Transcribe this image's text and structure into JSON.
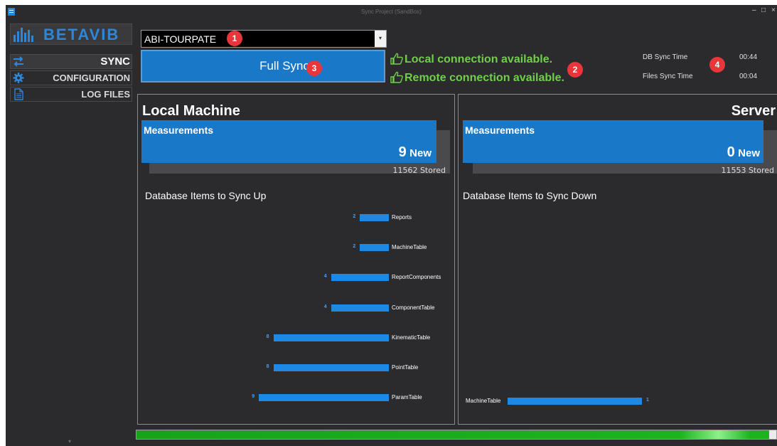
{
  "window": {
    "title": "Sync Project (SandBox)",
    "minimize": "–",
    "maximize": "□",
    "close": "×"
  },
  "sidebar": {
    "logo_text": "BETAVIB",
    "items": [
      {
        "label": "SYNC",
        "icon": "sync-arrows-icon",
        "active": true
      },
      {
        "label": "CONFIGURATION",
        "icon": "gear-icon",
        "active": false
      },
      {
        "label": "LOG FILES",
        "icon": "document-icon",
        "active": false
      }
    ],
    "scroll_arrow": "▾"
  },
  "project": {
    "selected": "ABI-TOURPATE",
    "arrow": "▾"
  },
  "buttons": {
    "full_sync": "Full Sync"
  },
  "status": {
    "local": "Local connection available.",
    "remote": "Remote connection available.",
    "color": "#6fcf4a",
    "icon": "thumbs-up-icon"
  },
  "sync_times": {
    "db_label": "DB Sync Time",
    "db_value": "00:44",
    "files_label": "Files Sync Time",
    "files_value": "00:04"
  },
  "badges": [
    "1",
    "2",
    "3",
    "4"
  ],
  "local": {
    "title": "Local Machine",
    "measurements_title": "Measurements",
    "new_count": "9",
    "new_label": "New",
    "stored": "11562  Stored",
    "db_title": "Database Items to Sync Up"
  },
  "server": {
    "title": "Server",
    "measurements_title": "Measurements",
    "new_count": "0",
    "new_label": "New",
    "stored": "11553  Stored",
    "db_title": "Database Items to Sync Down"
  },
  "chart_data": [
    {
      "type": "bar",
      "orientation": "horizontal",
      "categories": [
        "Reports",
        "MachineTable",
        "ReportComponents",
        "ComponentTable",
        "KinematicTable",
        "PointTable",
        "ParamTable"
      ],
      "values": [
        2,
        2,
        4,
        4,
        8,
        8,
        9
      ],
      "color": "#1e88e5"
    },
    {
      "type": "bar",
      "orientation": "horizontal",
      "categories": [
        "MachineTable"
      ],
      "values": [
        1
      ],
      "color": "#1e88e5"
    }
  ],
  "progress": {
    "value": 0.989,
    "color": "#1db31f"
  }
}
